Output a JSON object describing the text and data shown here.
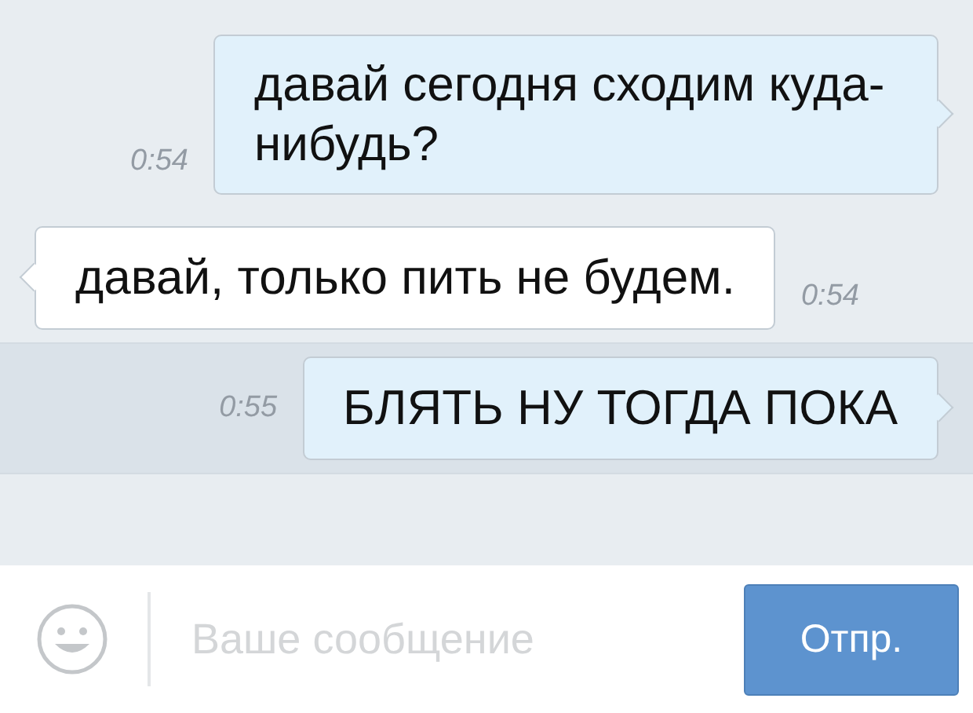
{
  "messages": [
    {
      "kind": "outgoing",
      "text": "давай сегодня сходим куда-нибудь?",
      "time": "0:54",
      "selected": false
    },
    {
      "kind": "incoming",
      "text": "давай, только пить не будем.",
      "time": "0:54",
      "selected": false
    },
    {
      "kind": "outgoing",
      "text": "БЛЯТЬ НУ ТОГДА ПОКА",
      "time": "0:55",
      "selected": true
    }
  ],
  "composer": {
    "placeholder": "Ваше сообщение",
    "send_button": "Отпр."
  }
}
